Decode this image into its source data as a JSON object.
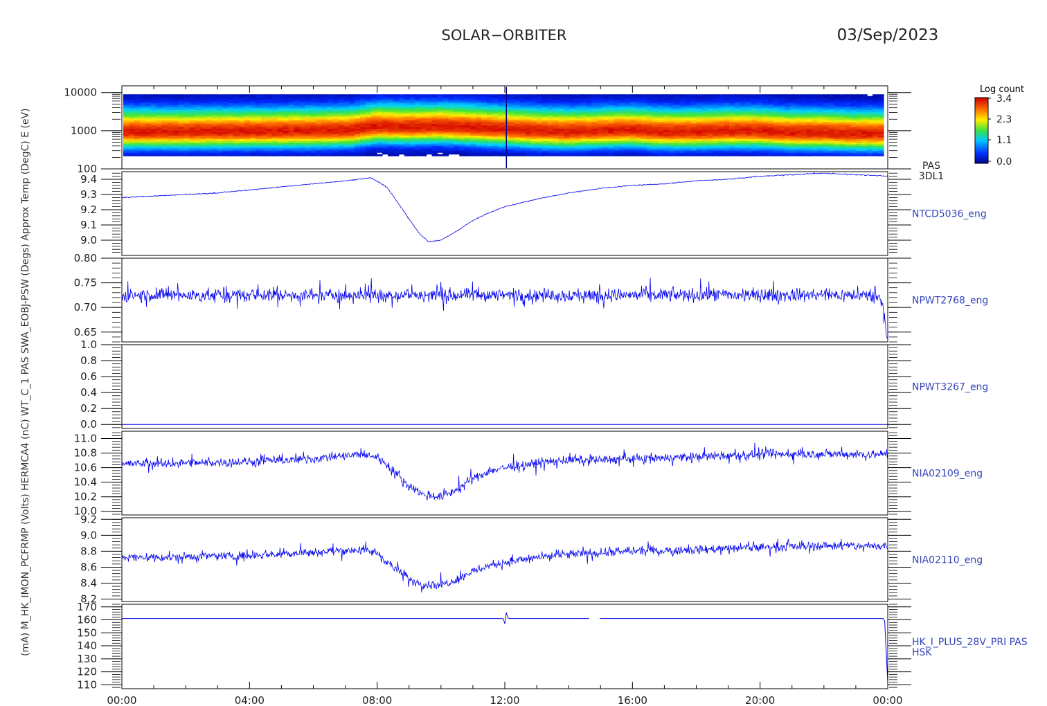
{
  "header": {
    "title": "SOLAR−ORBITER",
    "date": "03/Sep/2023"
  },
  "colorbar": {
    "title": "Log count",
    "ticks": [
      "3.4",
      "2.3",
      "1.1",
      "0.0"
    ]
  },
  "x_axis": {
    "ticks": [
      "00:00",
      "04:00",
      "08:00",
      "12:00",
      "16:00",
      "20:00",
      "00:00"
    ],
    "range_hours": [
      0,
      24
    ]
  },
  "left_label_text": "(mA)  M_HK_IMON_PCFRMP  (Volts)  HERMCA4  (nC)  WT_C_1  PAS  SWA_EOBJ-PSW  (Degs)  Approx Temp  (DegC)  E (eV)",
  "chart_data": [
    {
      "type": "heatmap",
      "name": "PAS 3DL1",
      "label_lines": [
        "PAS",
        "3DL1"
      ],
      "ylabel": "E (eV)",
      "yscale": "log",
      "ylim": [
        100,
        15000
      ],
      "yticks": [
        "10000",
        "1000",
        "100"
      ],
      "ytick_values": [
        10000,
        1000,
        100
      ],
      "zlim": [
        0.0,
        3.4
      ],
      "peak_energy_profile": {
        "hours": [
          0,
          2,
          4,
          6,
          7.2,
          8,
          9,
          10,
          11,
          12,
          13,
          14,
          15,
          16,
          17,
          18,
          19,
          20,
          21,
          22,
          23,
          24
        ],
        "energy_ev": [
          950,
          950,
          980,
          1000,
          1050,
          1300,
          1250,
          1300,
          1200,
          1100,
          1000,
          950,
          1000,
          1050,
          950,
          950,
          1000,
          1000,
          900,
          900,
          850,
          850
        ]
      }
    },
    {
      "type": "line",
      "name": "NTCD5036_eng",
      "ylim": [
        8.9,
        9.45
      ],
      "yticks": [
        "9.4",
        "9.3",
        "9.2",
        "9.1",
        "9.0"
      ],
      "ytick_values": [
        9.4,
        9.3,
        9.2,
        9.1,
        9.0
      ],
      "x": [
        0,
        1,
        2,
        3,
        4,
        5,
        6,
        7,
        7.8,
        8.3,
        8.8,
        9.3,
        9.6,
        10,
        10.5,
        11,
        11.5,
        12,
        13,
        14,
        15,
        16,
        17,
        18,
        19,
        20,
        21,
        22,
        23,
        24
      ],
      "y": [
        9.28,
        9.29,
        9.3,
        9.31,
        9.33,
        9.35,
        9.37,
        9.39,
        9.41,
        9.35,
        9.2,
        9.05,
        8.99,
        9.0,
        9.06,
        9.13,
        9.18,
        9.22,
        9.27,
        9.31,
        9.34,
        9.36,
        9.37,
        9.39,
        9.4,
        9.42,
        9.43,
        9.44,
        9.43,
        9.42
      ],
      "noise": 0.004
    },
    {
      "type": "line",
      "name": "NPWT2768_eng",
      "ylim": [
        0.63,
        0.8
      ],
      "yticks": [
        "0.80",
        "0.75",
        "0.70",
        "0.65"
      ],
      "ytick_values": [
        0.8,
        0.75,
        0.7,
        0.65
      ],
      "x": [
        0,
        23.6,
        23.8,
        24
      ],
      "y": [
        0.725,
        0.725,
        0.72,
        0.64
      ],
      "noise": 0.02
    },
    {
      "type": "line",
      "name": "NPWT3267_eng",
      "ylim": [
        -0.05,
        1.0
      ],
      "yticks": [
        "1.0",
        "0.8",
        "0.6",
        "0.4",
        "0.2",
        "0.0"
      ],
      "ytick_values": [
        1.0,
        0.8,
        0.6,
        0.4,
        0.2,
        0.0
      ],
      "x": [
        0,
        24
      ],
      "y": [
        0.0,
        0.0
      ],
      "noise": 0.0
    },
    {
      "type": "line",
      "name": "NIA02109_eng",
      "ylim": [
        9.95,
        11.1
      ],
      "yticks": [
        "11.0",
        "10.8",
        "10.6",
        "10.4",
        "10.2",
        "10.0"
      ],
      "ytick_values": [
        11.0,
        10.8,
        10.6,
        10.4,
        10.2,
        10.0
      ],
      "x": [
        0,
        2,
        4,
        6,
        7.5,
        8,
        8.5,
        9,
        9.5,
        10,
        10.5,
        11,
        11.5,
        12,
        13,
        14,
        16,
        18,
        20,
        22,
        24
      ],
      "y": [
        10.65,
        10.66,
        10.68,
        10.72,
        10.78,
        10.75,
        10.55,
        10.35,
        10.22,
        10.2,
        10.3,
        10.45,
        10.55,
        10.6,
        10.66,
        10.7,
        10.72,
        10.75,
        10.78,
        10.79,
        10.78
      ],
      "noise": 0.09
    },
    {
      "type": "line",
      "name": "NIA02110_eng",
      "ylim": [
        8.17,
        9.22
      ],
      "yticks": [
        "9.2",
        "9.0",
        "8.8",
        "8.6",
        "8.4",
        "8.2"
      ],
      "ytick_values": [
        9.2,
        9.0,
        8.8,
        8.6,
        8.4,
        8.2
      ],
      "x": [
        0,
        2,
        4,
        6,
        7.5,
        8,
        8.5,
        9,
        9.5,
        10,
        10.5,
        11,
        11.5,
        12,
        13,
        14,
        16,
        18,
        20,
        22,
        24
      ],
      "y": [
        8.72,
        8.73,
        8.75,
        8.79,
        8.82,
        8.78,
        8.6,
        8.45,
        8.38,
        8.38,
        8.45,
        8.55,
        8.62,
        8.66,
        8.72,
        8.76,
        8.8,
        8.82,
        8.85,
        8.87,
        8.86
      ],
      "noise": 0.08
    },
    {
      "type": "line",
      "name": "HK_I_PLUS_28V_PRI PAS HSK",
      "label_lines": [
        "HK_I_PLUS_28V_PRI PAS",
        "HSK"
      ],
      "ylim": [
        107,
        172
      ],
      "yticks": [
        "170",
        "160",
        "150",
        "140",
        "130",
        "120",
        "110"
      ],
      "ytick_values": [
        170,
        160,
        150,
        140,
        130,
        120,
        110
      ],
      "x": [
        0,
        11.95,
        12.0,
        12.05,
        12.1,
        14.6,
        14.95,
        23.9,
        24
      ],
      "y": [
        161,
        161,
        157,
        166,
        161,
        161,
        161,
        161,
        112
      ],
      "gap": [
        14.65,
        14.95
      ],
      "noise": 0.0
    }
  ]
}
